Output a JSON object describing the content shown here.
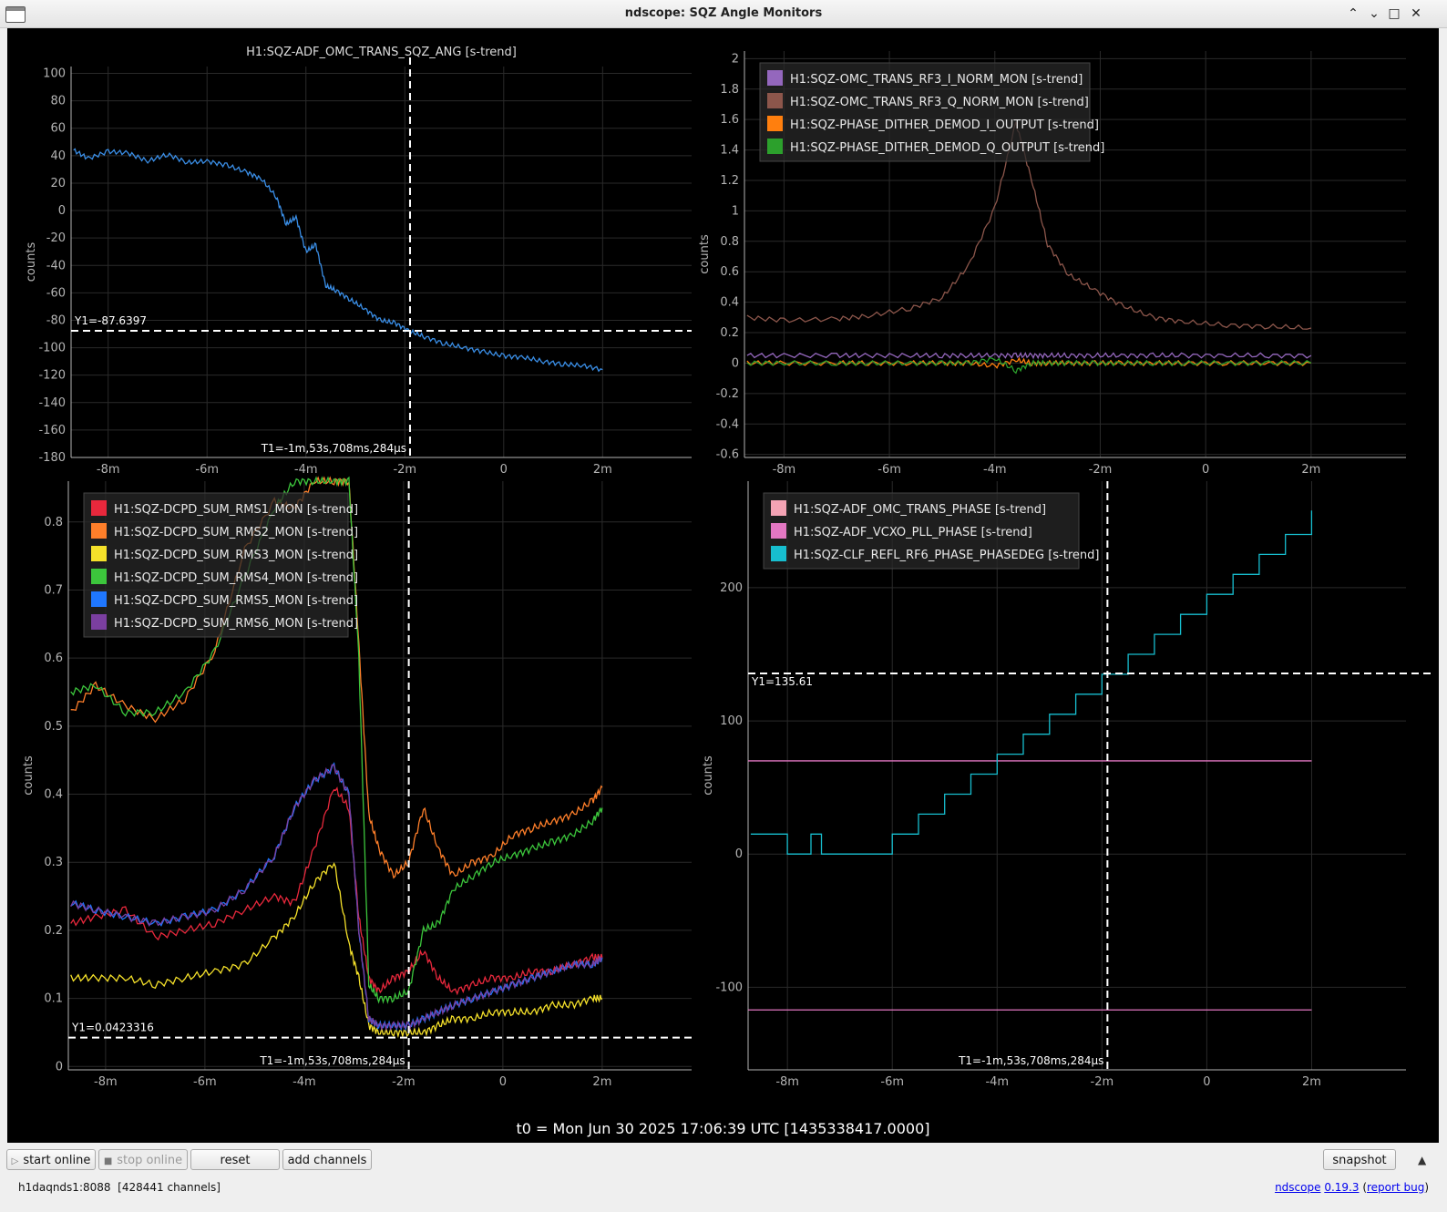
{
  "window": {
    "title": "ndscope: SQZ Angle Monitors"
  },
  "colors": {
    "background": "#000000",
    "axis": "#b4b4b4",
    "grid": "#2a2a2a",
    "cursor": "#ffffff"
  },
  "plots": [
    {
      "id": "top-left",
      "title": "H1:SQZ-ADF_OMC_TRANS_SQZ_ANG [s-trend]",
      "ylabel": "counts",
      "y_ticks": [
        "100",
        "80",
        "60",
        "40",
        "20",
        "0",
        "-20",
        "-40",
        "-60",
        "-80",
        "-100",
        "-120",
        "-140",
        "-160",
        "-180"
      ],
      "x_ticks": [
        "-8m",
        "-6m",
        "-4m",
        "-2m",
        "0",
        "2m"
      ],
      "cursor_y_label": "Y1=-87.6397",
      "cursor_t_label": "T1=-1m,53s,708ms,284μs",
      "legend": []
    },
    {
      "id": "top-right",
      "title": "",
      "ylabel": "counts",
      "y_ticks": [
        "2",
        "1.8",
        "1.6",
        "1.4",
        "1.2",
        "1",
        "0.8",
        "0.6",
        "0.4",
        "0.2",
        "0",
        "-0.2",
        "-0.4",
        "-0.6"
      ],
      "x_ticks": [
        "-8m",
        "-6m",
        "-4m",
        "-2m",
        "0",
        "2m"
      ],
      "legend": [
        {
          "label": "H1:SQZ-OMC_TRANS_RF3_I_NORM_MON [s-trend]",
          "color": "#9467bd"
        },
        {
          "label": "H1:SQZ-OMC_TRANS_RF3_Q_NORM_MON [s-trend]",
          "color": "#8c564b"
        },
        {
          "label": "H1:SQZ-PHASE_DITHER_DEMOD_I_OUTPUT [s-trend]",
          "color": "#ff7f0e"
        },
        {
          "label": "H1:SQZ-PHASE_DITHER_DEMOD_Q_OUTPUT [s-trend]",
          "color": "#2ca02c"
        }
      ]
    },
    {
      "id": "bottom-left",
      "title": "",
      "ylabel": "counts",
      "y_ticks": [
        "0.8",
        "0.7",
        "0.6",
        "0.5",
        "0.4",
        "0.3",
        "0.2",
        "0.1",
        "0"
      ],
      "x_ticks": [
        "-8m",
        "-6m",
        "-4m",
        "-2m",
        "0",
        "2m"
      ],
      "cursor_y_label": "Y1=0.0423316",
      "cursor_t_label": "T1=-1m,53s,708ms,284μs",
      "legend": [
        {
          "label": "H1:SQZ-DCPD_SUM_RMS1_MON [s-trend]",
          "color": "#e8283c"
        },
        {
          "label": "H1:SQZ-DCPD_SUM_RMS2_MON [s-trend]",
          "color": "#ff7f2a"
        },
        {
          "label": "H1:SQZ-DCPD_SUM_RMS3_MON [s-trend]",
          "color": "#f5e12a"
        },
        {
          "label": "H1:SQZ-DCPD_SUM_RMS4_MON [s-trend]",
          "color": "#3cc63c"
        },
        {
          "label": "H1:SQZ-DCPD_SUM_RMS5_MON [s-trend]",
          "color": "#1f77ff"
        },
        {
          "label": "H1:SQZ-DCPD_SUM_RMS6_MON [s-trend]",
          "color": "#7b3fa0"
        }
      ]
    },
    {
      "id": "bottom-right",
      "title": "",
      "ylabel": "counts",
      "y_ticks": [
        "200",
        "100",
        "0",
        "-100"
      ],
      "x_ticks": [
        "-8m",
        "-6m",
        "-4m",
        "-2m",
        "0",
        "2m"
      ],
      "cursor_y_label": "Y1=135.61",
      "cursor_t_label": "T1=-1m,53s,708ms,284μs",
      "legend": [
        {
          "label": "H1:SQZ-ADF_OMC_TRANS_PHASE [s-trend]",
          "color": "#f4a3b4"
        },
        {
          "label": "H1:SQZ-ADF_VCXO_PLL_PHASE [s-trend]",
          "color": "#e377c2"
        },
        {
          "label": "H1:SQZ-CLF_REFL_RF6_PHASE_PHASEDEG [s-trend]",
          "color": "#17becf"
        }
      ]
    }
  ],
  "chart_data": [
    {
      "type": "line",
      "title": "H1:SQZ-ADF_OMC_TRANS_SQZ_ANG [s-trend]",
      "xlabel": "",
      "ylabel": "counts",
      "xlim": [
        -8.75,
        3.8
      ],
      "ylim": [
        -180,
        105
      ],
      "x": [
        -8.7,
        -8.4,
        -8.0,
        -7.6,
        -7.2,
        -6.8,
        -6.4,
        -6.0,
        -5.6,
        -5.2,
        -4.9,
        -4.6,
        -4.4,
        -4.2,
        -4.0,
        -3.8,
        -3.6,
        -3.4,
        -3.1,
        -2.8,
        -2.5,
        -2.2,
        -1.9,
        -1.6,
        -1.2,
        -0.8,
        -0.4,
        0.0,
        0.4,
        0.8,
        1.2,
        1.6,
        2.0
      ],
      "series": [
        {
          "name": "H1:SQZ-ADF_OMC_TRANS_SQZ_ANG [s-trend]",
          "color": "#3a8ee6",
          "values": [
            44,
            38,
            43,
            42,
            36,
            41,
            35,
            36,
            33,
            28,
            23,
            10,
            -10,
            -5,
            -30,
            -25,
            -55,
            -58,
            -65,
            -72,
            -80,
            -82,
            -88,
            -92,
            -97,
            -100,
            -103,
            -106,
            -107,
            -110,
            -112,
            -113,
            -116
          ]
        }
      ],
      "cursor": {
        "t": -1.895,
        "y": -87.6397
      }
    },
    {
      "type": "line",
      "title": "",
      "xlabel": "",
      "ylabel": "counts",
      "xlim": [
        -8.75,
        3.8
      ],
      "ylim": [
        -0.62,
        2.05
      ],
      "x": [
        -8.7,
        -8.0,
        -7.0,
        -6.4,
        -5.6,
        -5.0,
        -4.5,
        -4.0,
        -3.6,
        -3.3,
        -3.0,
        -2.6,
        -2.1,
        -1.6,
        -1.0,
        -0.4,
        0.4,
        1.2,
        2.0
      ],
      "series": [
        {
          "name": "H1:SQZ-OMC_TRANS_RF3_I_NORM_MON [s-trend]",
          "color": "#9467bd",
          "values": [
            0.05,
            0.05,
            0.05,
            0.05,
            0.05,
            0.05,
            0.05,
            0.05,
            0.05,
            0.05,
            0.05,
            0.05,
            0.05,
            0.05,
            0.05,
            0.05,
            0.05,
            0.05,
            0.05
          ]
        },
        {
          "name": "H1:SQZ-OMC_TRANS_RF3_Q_NORM_MON [s-trend]",
          "color": "#8c564b",
          "values": [
            0.3,
            0.28,
            0.29,
            0.31,
            0.36,
            0.43,
            0.64,
            1.02,
            1.58,
            1.2,
            0.78,
            0.58,
            0.48,
            0.38,
            0.3,
            0.27,
            0.25,
            0.24,
            0.23
          ]
        },
        {
          "name": "H1:SQZ-PHASE_DITHER_DEMOD_I_OUTPUT [s-trend]",
          "color": "#ff7f0e",
          "values": [
            0,
            0,
            0,
            0,
            0,
            0,
            0,
            -0.02,
            0.02,
            0,
            0,
            0,
            0,
            0,
            0,
            0,
            0,
            0,
            0
          ]
        },
        {
          "name": "H1:SQZ-PHASE_DITHER_DEMOD_Q_OUTPUT [s-trend]",
          "color": "#2ca02c",
          "values": [
            0,
            0,
            0,
            0,
            0,
            0,
            0,
            0.03,
            -0.05,
            0,
            0,
            0,
            0,
            0,
            0,
            0,
            0,
            0,
            0
          ]
        }
      ]
    },
    {
      "type": "line",
      "title": "",
      "xlabel": "",
      "ylabel": "counts",
      "xlim": [
        -8.75,
        3.8
      ],
      "ylim": [
        -0.005,
        0.86
      ],
      "x": [
        -8.7,
        -8.2,
        -7.6,
        -7.0,
        -6.4,
        -5.8,
        -5.2,
        -4.6,
        -4.2,
        -3.8,
        -3.4,
        -3.1,
        -2.9,
        -2.7,
        -2.5,
        -2.2,
        -1.9,
        -1.6,
        -1.3,
        -1.0,
        -0.6,
        -0.2,
        0.2,
        0.6,
        1.0,
        1.4,
        1.8,
        2.0
      ],
      "series": [
        {
          "name": "H1:SQZ-DCPD_SUM_RMS1_MON [s-trend]",
          "color": "#e8283c",
          "values": [
            0.21,
            0.22,
            0.23,
            0.19,
            0.2,
            0.21,
            0.23,
            0.25,
            0.24,
            0.32,
            0.41,
            0.38,
            0.22,
            0.13,
            0.11,
            0.13,
            0.14,
            0.17,
            0.13,
            0.11,
            0.12,
            0.13,
            0.13,
            0.14,
            0.14,
            0.15,
            0.16,
            0.16
          ]
        },
        {
          "name": "H1:SQZ-DCPD_SUM_RMS2_MON [s-trend]",
          "color": "#ff7f2a",
          "values": [
            0.52,
            0.56,
            0.53,
            0.51,
            0.54,
            0.61,
            0.76,
            0.83,
            0.82,
            0.86,
            0.86,
            0.86,
            0.62,
            0.37,
            0.32,
            0.28,
            0.3,
            0.38,
            0.32,
            0.28,
            0.3,
            0.31,
            0.34,
            0.35,
            0.36,
            0.37,
            0.39,
            0.41
          ]
        },
        {
          "name": "H1:SQZ-DCPD_SUM_RMS3_MON [s-trend]",
          "color": "#f5e12a",
          "values": [
            0.13,
            0.13,
            0.13,
            0.12,
            0.13,
            0.14,
            0.15,
            0.19,
            0.22,
            0.27,
            0.3,
            0.18,
            0.13,
            0.06,
            0.05,
            0.05,
            0.05,
            0.05,
            0.06,
            0.07,
            0.07,
            0.08,
            0.08,
            0.08,
            0.09,
            0.09,
            0.1,
            0.1
          ]
        },
        {
          "name": "H1:SQZ-DCPD_SUM_RMS4_MON [s-trend]",
          "color": "#3cc63c",
          "values": [
            0.55,
            0.56,
            0.52,
            0.52,
            0.55,
            0.61,
            0.72,
            0.82,
            0.86,
            0.86,
            0.86,
            0.86,
            0.6,
            0.12,
            0.1,
            0.1,
            0.11,
            0.2,
            0.21,
            0.26,
            0.28,
            0.3,
            0.31,
            0.32,
            0.33,
            0.34,
            0.36,
            0.38
          ]
        },
        {
          "name": "H1:SQZ-DCPD_SUM_RMS5_MON [s-trend]",
          "color": "#1f77ff",
          "values": [
            0.24,
            0.23,
            0.22,
            0.21,
            0.22,
            0.23,
            0.26,
            0.31,
            0.38,
            0.42,
            0.44,
            0.4,
            0.2,
            0.07,
            0.06,
            0.06,
            0.06,
            0.07,
            0.08,
            0.09,
            0.1,
            0.11,
            0.12,
            0.13,
            0.14,
            0.15,
            0.15,
            0.16
          ]
        },
        {
          "name": "H1:SQZ-DCPD_SUM_RMS6_MON [s-trend]",
          "color": "#7b3fa0",
          "values": [
            0.24,
            0.23,
            0.22,
            0.21,
            0.22,
            0.23,
            0.26,
            0.31,
            0.38,
            0.42,
            0.44,
            0.4,
            0.2,
            0.07,
            0.06,
            0.06,
            0.06,
            0.07,
            0.08,
            0.09,
            0.1,
            0.11,
            0.12,
            0.13,
            0.14,
            0.15,
            0.15,
            0.16
          ]
        }
      ],
      "cursor": {
        "t": -1.895,
        "y": 0.0423316
      }
    },
    {
      "type": "line",
      "title": "",
      "xlabel": "",
      "ylabel": "counts",
      "xlim": [
        -8.75,
        3.8
      ],
      "ylim": [
        -162,
        280
      ],
      "x_step": [
        -8.7,
        -8.0,
        -7.55,
        -7.35,
        -7.2,
        -6.0,
        -5.5,
        -5.0,
        -4.5,
        -4.0,
        -3.5,
        -3.0,
        -2.5,
        -2.0,
        -1.5,
        -1.0,
        -0.5,
        0.0,
        0.5,
        1.0,
        1.5,
        2.0
      ],
      "series": [
        {
          "name": "H1:SQZ-ADF_OMC_TRANS_PHASE [s-trend]",
          "color": "#f4a3b4",
          "values": []
        },
        {
          "name": "H1:SQZ-ADF_VCXO_PLL_PHASE [s-trend]",
          "color": "#e377c2",
          "values": [
            70,
            -117
          ]
        },
        {
          "name": "H1:SQZ-CLF_REFL_RF6_PHASE_PHASEDEG [s-trend]",
          "color": "#17becf",
          "values": [
            15,
            0,
            15,
            0,
            0,
            15,
            30,
            45,
            60,
            75,
            90,
            105,
            120,
            135,
            150,
            165,
            180,
            195,
            210,
            225,
            240,
            258
          ]
        }
      ],
      "cursor": {
        "t": -1.895,
        "y": 135.61
      }
    }
  ],
  "footer": {
    "t0": "t0 = Mon Jun 30 2025 17:06:39 UTC [1435338417.0000]"
  },
  "toolbar": {
    "start_online": "start online",
    "stop_online": "stop online",
    "reset": "reset",
    "add_channels": "add channels",
    "snapshot": "snapshot",
    "collapse_glyph": "▲"
  },
  "status": {
    "server": "h1daqnds1:8088",
    "channels": "[428441 channels]",
    "app_name": "ndscope",
    "version": "0.19.3",
    "report_bug": "report bug",
    "report_open": "(",
    "report_close": ")"
  }
}
